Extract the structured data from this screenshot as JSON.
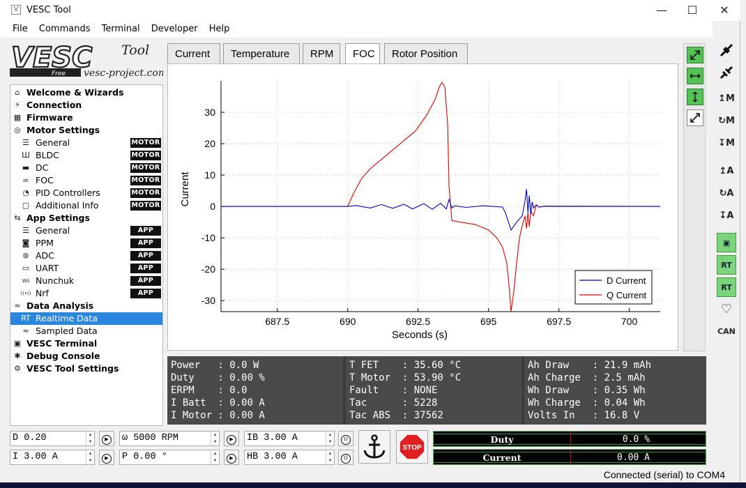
{
  "window": {
    "title": "VESC Tool",
    "minimize": "—",
    "maximize": "☐",
    "close": "✕"
  },
  "menu": [
    "File",
    "Commands",
    "Terminal",
    "Developer",
    "Help"
  ],
  "logo": {
    "main": "VESC",
    "tool": "Tool",
    "free": "Free",
    "site": "vesc-project.com"
  },
  "tree": [
    {
      "label": "Welcome & Wizards",
      "bold": true,
      "indent": 0,
      "icon": "home-icon",
      "glyph": "⌂"
    },
    {
      "label": "Connection",
      "bold": true,
      "indent": 0,
      "icon": "plug-icon",
      "glyph": "⚡"
    },
    {
      "label": "Firmware",
      "bold": true,
      "indent": 0,
      "icon": "chip-icon",
      "glyph": "▦"
    },
    {
      "label": "Motor Settings",
      "bold": true,
      "indent": 0,
      "icon": "motor-icon",
      "glyph": "◎"
    },
    {
      "label": "General",
      "indent": 1,
      "badge": "MOTOR",
      "icon": "sliders-icon",
      "glyph": "☰"
    },
    {
      "label": "BLDC",
      "indent": 1,
      "badge": "MOTOR",
      "icon": "bldc-icon",
      "glyph": "Ш"
    },
    {
      "label": "DC",
      "indent": 1,
      "badge": "MOTOR",
      "icon": "battery-icon",
      "glyph": "▬"
    },
    {
      "label": "FOC",
      "indent": 1,
      "badge": "MOTOR",
      "icon": "coil-icon",
      "glyph": "∞"
    },
    {
      "label": "PID Controllers",
      "indent": 1,
      "badge": "MOTOR",
      "icon": "gauge-icon",
      "glyph": "◔"
    },
    {
      "label": "Additional Info",
      "indent": 1,
      "badge": "MOTOR",
      "icon": "comment-icon",
      "glyph": "▢"
    },
    {
      "label": "App Settings",
      "bold": true,
      "indent": 0,
      "icon": "app-icon",
      "glyph": "⇆"
    },
    {
      "label": "General",
      "indent": 1,
      "badge": "APP",
      "icon": "sliders-icon",
      "glyph": "☰"
    },
    {
      "label": "PPM",
      "indent": 1,
      "badge": "APP",
      "icon": "gamepad-icon",
      "glyph": "◙"
    },
    {
      "label": "ADC",
      "indent": 1,
      "badge": "APP",
      "icon": "adc-icon",
      "glyph": "⊛"
    },
    {
      "label": "UART",
      "indent": 1,
      "badge": "APP",
      "icon": "keyboard-icon",
      "glyph": "▭"
    },
    {
      "label": "Nunchuk",
      "indent": 1,
      "badge": "APP",
      "icon": "wii-icon",
      "glyph": "Wii"
    },
    {
      "label": "Nrf",
      "indent": 1,
      "badge": "APP",
      "icon": "radio-icon",
      "glyph": "((•))"
    },
    {
      "label": "Data Analysis",
      "bold": true,
      "indent": 0,
      "icon": "analysis-icon",
      "glyph": "≈"
    },
    {
      "label": "Realtime Data",
      "indent": 1,
      "selected": true,
      "icon": "realtime-icon",
      "glyph": "RT"
    },
    {
      "label": "Sampled Data",
      "indent": 1,
      "icon": "sampled-icon",
      "glyph": "≈"
    },
    {
      "label": "VESC Terminal",
      "bold": true,
      "indent": 0,
      "icon": "terminal-icon",
      "glyph": "▣"
    },
    {
      "label": "Debug Console",
      "bold": true,
      "indent": 0,
      "icon": "bug-icon",
      "glyph": "✱"
    },
    {
      "label": "VESC Tool Settings",
      "bold": true,
      "indent": 0,
      "icon": "gear-icon",
      "glyph": "⚙"
    }
  ],
  "tabs": [
    "Current",
    "Temperature",
    "RPM",
    "FOC",
    "Rotor Position"
  ],
  "active_tab": "FOC",
  "chart_data": {
    "type": "line",
    "xlabel": "Seconds (s)",
    "ylabel": "Current",
    "xlim": [
      685.5,
      701.1
    ],
    "ylim": [
      -33.5,
      40
    ],
    "xticks": [
      687.5,
      690,
      692.5,
      695,
      697.5,
      700
    ],
    "xtick_labels": [
      "687.5",
      "690",
      "692.5",
      "695",
      "697.5",
      "700"
    ],
    "yticks": [
      30,
      20,
      10,
      0,
      -10,
      -20,
      -30
    ],
    "grid": true,
    "legend": "bottom-right",
    "series": [
      {
        "name": "D Current",
        "color": "#0000cc",
        "x": [
          685.5,
          690.0,
          690.3,
          690.8,
          691.2,
          691.6,
          692.0,
          692.3,
          692.7,
          693.0,
          693.3,
          693.5,
          693.6,
          693.7,
          693.8,
          694.2,
          694.8,
          695.5,
          695.6,
          695.8,
          696.0,
          696.2,
          696.3,
          696.35,
          696.4,
          696.45,
          696.5,
          696.55,
          696.6,
          696.7,
          696.8,
          697.0,
          697.2,
          701.1
        ],
        "y": [
          0,
          0,
          0.3,
          -0.5,
          0.6,
          -0.6,
          0.7,
          -0.8,
          0.9,
          -0.9,
          1.0,
          -0.8,
          2.2,
          -0.5,
          0.2,
          -0.3,
          0.2,
          -0.2,
          -2.0,
          -7.5,
          -5.0,
          -3.0,
          2.0,
          5.5,
          -2.0,
          3.5,
          -2.5,
          1.5,
          -0.5,
          0.5,
          -0.2,
          0.1,
          0,
          0
        ]
      },
      {
        "name": "Q Current",
        "color": "#e00000",
        "x": [
          685.5,
          690.0,
          690.2,
          690.5,
          690.8,
          691.2,
          691.6,
          692.0,
          692.4,
          692.8,
          693.1,
          693.25,
          693.35,
          693.45,
          693.55,
          693.6,
          693.7,
          694.0,
          694.5,
          695.0,
          695.3,
          695.5,
          695.65,
          695.75,
          695.8,
          695.9,
          696.0,
          696.1,
          696.2,
          696.3,
          696.35,
          696.4,
          696.45,
          696.5,
          696.6,
          696.7,
          696.8,
          697.0,
          701.1
        ],
        "y": [
          0,
          0,
          4,
          9,
          12,
          15,
          18,
          21,
          24,
          29,
          34,
          38,
          39.5,
          38,
          26,
          6,
          -4.5,
          -5,
          -5.7,
          -7.5,
          -10,
          -13,
          -18,
          -27,
          -33.5,
          -27,
          -18,
          -10,
          -6,
          -3,
          -7,
          -2,
          -6.5,
          -1.5,
          -3,
          0.5,
          -0.2,
          0.1,
          0
        ]
      }
    ]
  },
  "stats": {
    "col1": [
      "Power   : 0.0 W",
      "Duty    : 0.00 %",
      "ERPM    : 0.0",
      "I Batt  : 0.00 A",
      "I Motor : 0.00 A"
    ],
    "col2": [
      "T FET    : 35.60 °C",
      "T Motor  : 53.90 °C",
      "Fault    : NONE",
      "Tac      : 5228",
      "Tac ABS  : 37562"
    ],
    "col3": [
      "Ah Draw    : 21.9 mAh",
      "Ah Charge  : 2.5 mAh",
      "Wh Draw    : 0.35 Wh",
      "Wh Charge  : 0.04 Wh",
      "Volts In   : 16.8 V"
    ]
  },
  "controls": {
    "duty": "D 0.20",
    "rpm": "ω 5000 RPM",
    "ib": "IB 3.00 A",
    "current": "I 3.00 A",
    "position": "P 0.00 °",
    "hb": "HB 3.00 A",
    "stop": "STOP"
  },
  "gauges": {
    "duty_label": "Duty",
    "duty_value": "0.0 %",
    "current_label": "Current",
    "current_value": "0.00 A"
  },
  "status": "Connected (serial) to COM4"
}
